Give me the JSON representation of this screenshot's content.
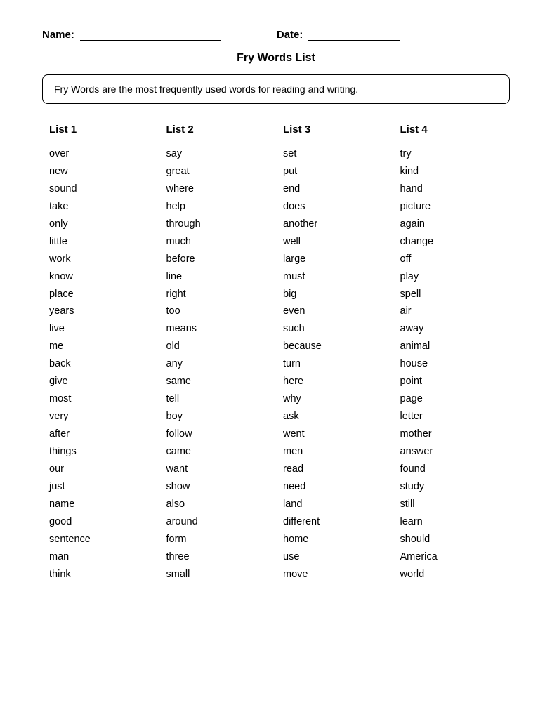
{
  "header": {
    "name_label": "Name:",
    "date_label": "Date:"
  },
  "title": "Fry Words List",
  "description": "Fry Words are the most frequently used words for reading and writing.",
  "lists": [
    {
      "header": "List 1",
      "words": [
        "over",
        "new",
        "sound",
        "take",
        "only",
        "little",
        "work",
        "know",
        "place",
        "years",
        "live",
        "me",
        "back",
        "give",
        "most",
        "very",
        "after",
        "things",
        "our",
        "just",
        "name",
        "good",
        "sentence",
        "man",
        "think"
      ]
    },
    {
      "header": "List 2",
      "words": [
        "say",
        "great",
        "where",
        "help",
        "through",
        "much",
        "before",
        "line",
        "right",
        "too",
        "means",
        "old",
        "any",
        "same",
        "tell",
        "boy",
        "follow",
        "came",
        "want",
        "show",
        "also",
        "around",
        "form",
        "three",
        "small"
      ]
    },
    {
      "header": "List 3",
      "words": [
        "set",
        "put",
        "end",
        "does",
        "another",
        "well",
        "large",
        "must",
        "big",
        "even",
        "such",
        "because",
        "turn",
        "here",
        "why",
        "ask",
        "went",
        "men",
        "read",
        "need",
        "land",
        "different",
        "home",
        "use",
        "move"
      ]
    },
    {
      "header": "List 4",
      "words": [
        "try",
        "kind",
        "hand",
        "picture",
        "again",
        "change",
        "off",
        "play",
        "spell",
        "air",
        "away",
        "animal",
        "house",
        "point",
        "page",
        "letter",
        "mother",
        "answer",
        "found",
        "study",
        "still",
        "learn",
        "should",
        "America",
        "world"
      ]
    }
  ]
}
